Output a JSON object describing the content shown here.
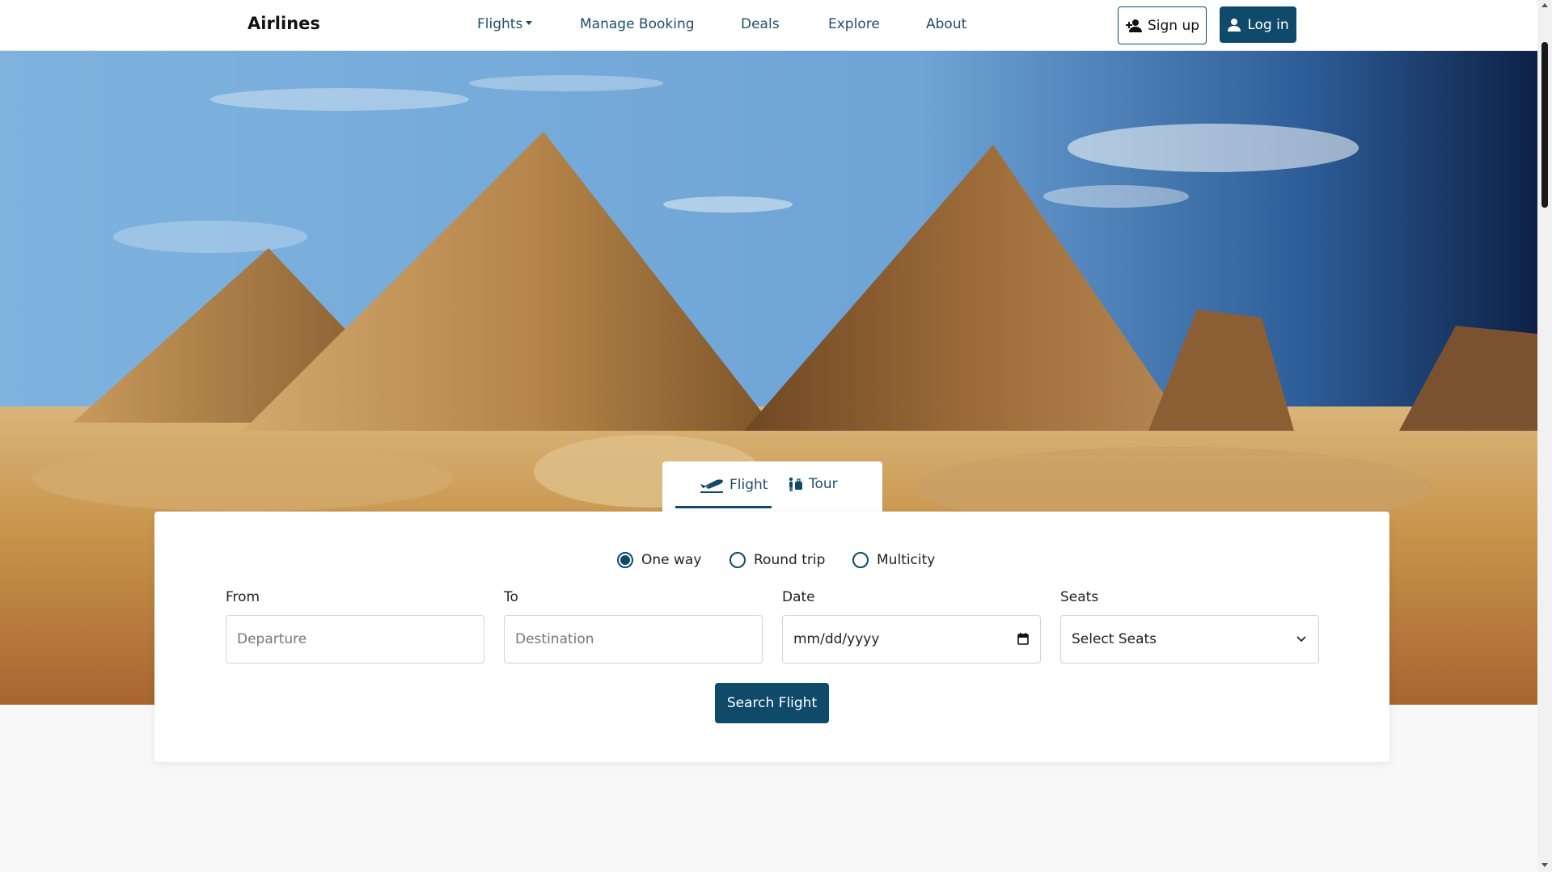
{
  "navbar": {
    "brand": "Airlines",
    "links": {
      "flights": "Flights",
      "manage_booking": "Manage Booking",
      "deals": "Deals",
      "explore": "Explore",
      "about": "About"
    },
    "signup_label": "Sign up",
    "login_label": "Log in"
  },
  "hero": {
    "image": "pyramids-desert-photo"
  },
  "tabs": {
    "flight": "Flight",
    "tour": "Tour",
    "active": "Flight"
  },
  "search": {
    "trip_types": {
      "one_way": "One way",
      "round_trip": "Round trip",
      "multicity": "Multicity",
      "selected": "One way"
    },
    "from_label": "From",
    "from_placeholder": "Departure",
    "to_label": "To",
    "to_placeholder": "Destination",
    "date_label": "Date",
    "date_placeholder": "mm/dd/yyyy",
    "seats_label": "Seats",
    "seats_value": "Select Seats",
    "submit_label": "Search Flight"
  },
  "colors": {
    "primary": "#0f4a6b",
    "nav_text": "#1f4e6b",
    "page_bg": "#f8f8f8"
  }
}
